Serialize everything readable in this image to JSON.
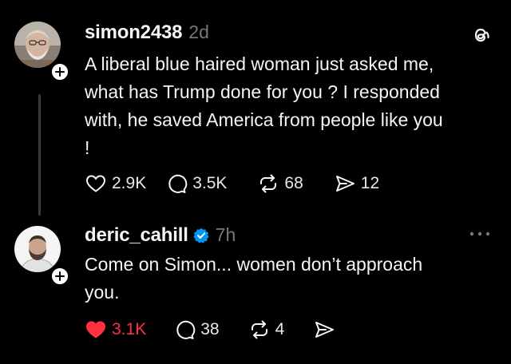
{
  "posts": [
    {
      "username": "simon2438",
      "time": "2d",
      "lines": [
        "A liberal blue haired woman just asked me,",
        "what has Trump done for you ? I responded",
        "with, he saved America from people like you",
        "!"
      ],
      "stats": {
        "likes": "2.9K",
        "replies": "3.5K",
        "reposts": "68",
        "shares": "12"
      },
      "liked": false
    },
    {
      "username": "deric_cahill",
      "verified": true,
      "time": "7h",
      "lines": [
        "Come on Simon... women don’t approach",
        "you."
      ],
      "stats": {
        "likes": "3.1K",
        "replies": "38",
        "reposts": "4"
      },
      "liked": true
    }
  ],
  "icons": {
    "top_right": "threads-logo-icon",
    "more": "more-options-icon"
  },
  "colors": {
    "background": "#000000",
    "like_active": "#ff3040",
    "verified_blue": "#0095f6",
    "muted": "#777777"
  }
}
